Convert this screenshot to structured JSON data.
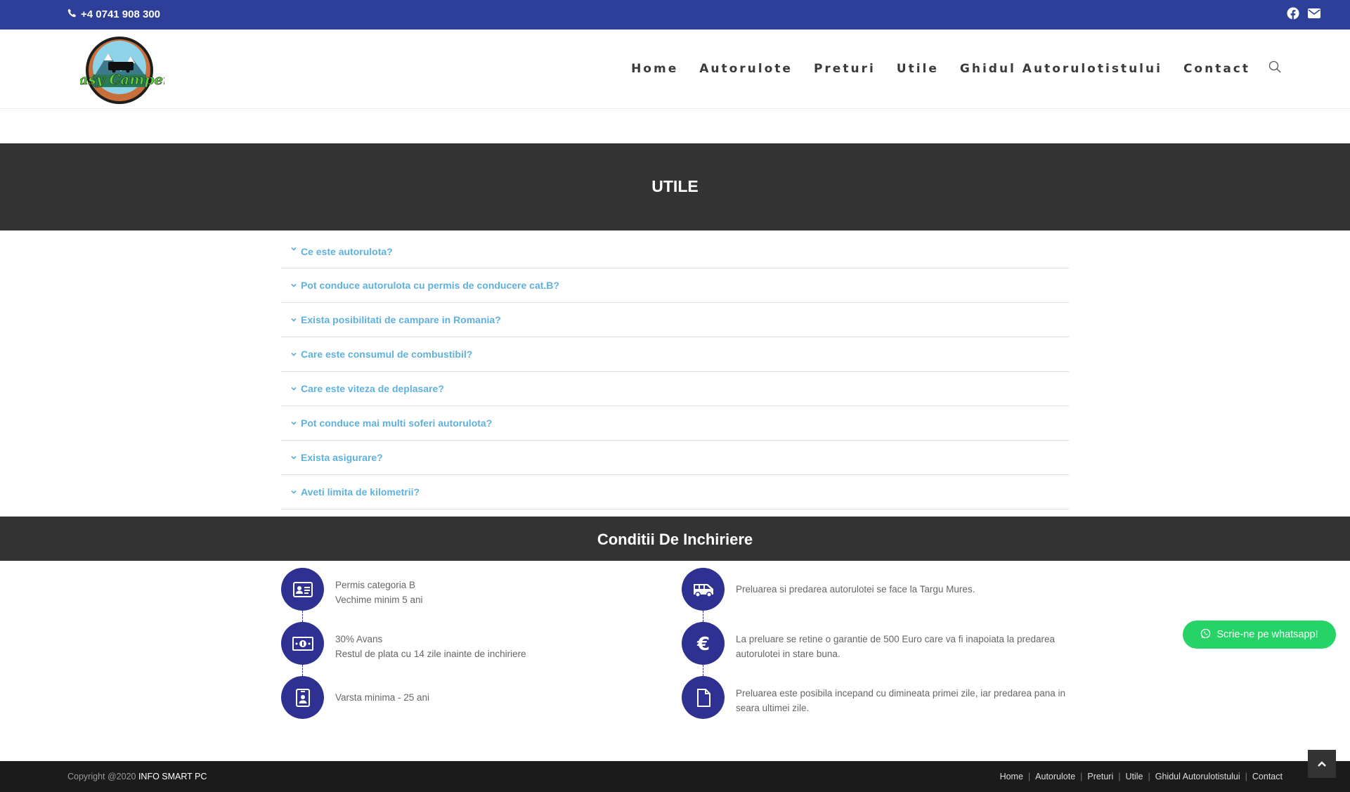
{
  "topbar": {
    "phone": "+4 0741 908 300"
  },
  "logo": {
    "brand_text": "Easy Camper"
  },
  "nav": {
    "items": [
      "Home",
      "Autorulote",
      "Preturi",
      "Utile",
      "Ghidul Autorulotistului",
      "Contact"
    ]
  },
  "hero": {
    "title": "UTILE"
  },
  "faq": {
    "items": [
      "Ce este autorulota?",
      "Pot conduce autorulota cu permis de conducere cat.B?",
      "Exista posibilitati de campare in Romania?",
      "Care este consumul de combustibil?",
      "Care este viteza de deplasare?",
      "Pot conduce mai multi soferi autorulota?",
      "Exista asigurare?",
      "Aveti limita de kilometrii?"
    ]
  },
  "conditions": {
    "title": "Conditii De Inchiriere",
    "left": [
      {
        "line1": "Permis categoria B",
        "line2": "Vechime minim 5 ani",
        "icon": "id-card-icon"
      },
      {
        "line1": "30% Avans",
        "line2": "Restul de plata cu 14 zile inainte de inchiriere",
        "icon": "money-bill-icon"
      },
      {
        "line1": "Varsta minima - 25 ani",
        "line2": "",
        "icon": "id-badge-icon"
      }
    ],
    "right": [
      {
        "line1": "Preluarea si predarea autorulotei se face la Targu Mures.",
        "line2": "",
        "icon": "shuttle-van-icon"
      },
      {
        "line1": "La preluare se retine o garantie de 500 Euro care va fi inapoiata la predarea autorulotei in stare buna.",
        "line2": "",
        "icon": "euro-icon"
      },
      {
        "line1": "Preluarea este posibila incepand cu dimineata primei zile, iar predarea pana in seara ultimei zile.",
        "line2": "",
        "icon": "file-icon"
      }
    ]
  },
  "whatsapp": {
    "label": "Scrie-ne pe whatsapp!"
  },
  "footer": {
    "copyright_prefix": "Copyright @2020",
    "copyright_brand": "INFO SMART PC",
    "links": [
      "Home",
      "Autorulote",
      "Preturi",
      "Utile",
      "Ghidul Autorulotistului",
      "Contact"
    ]
  },
  "colors": {
    "topbar": "#2e3f99",
    "accent_link": "#5fb1dc",
    "icon_circle": "#2e3192",
    "dark_band": "#333333",
    "whatsapp": "#25d366"
  }
}
